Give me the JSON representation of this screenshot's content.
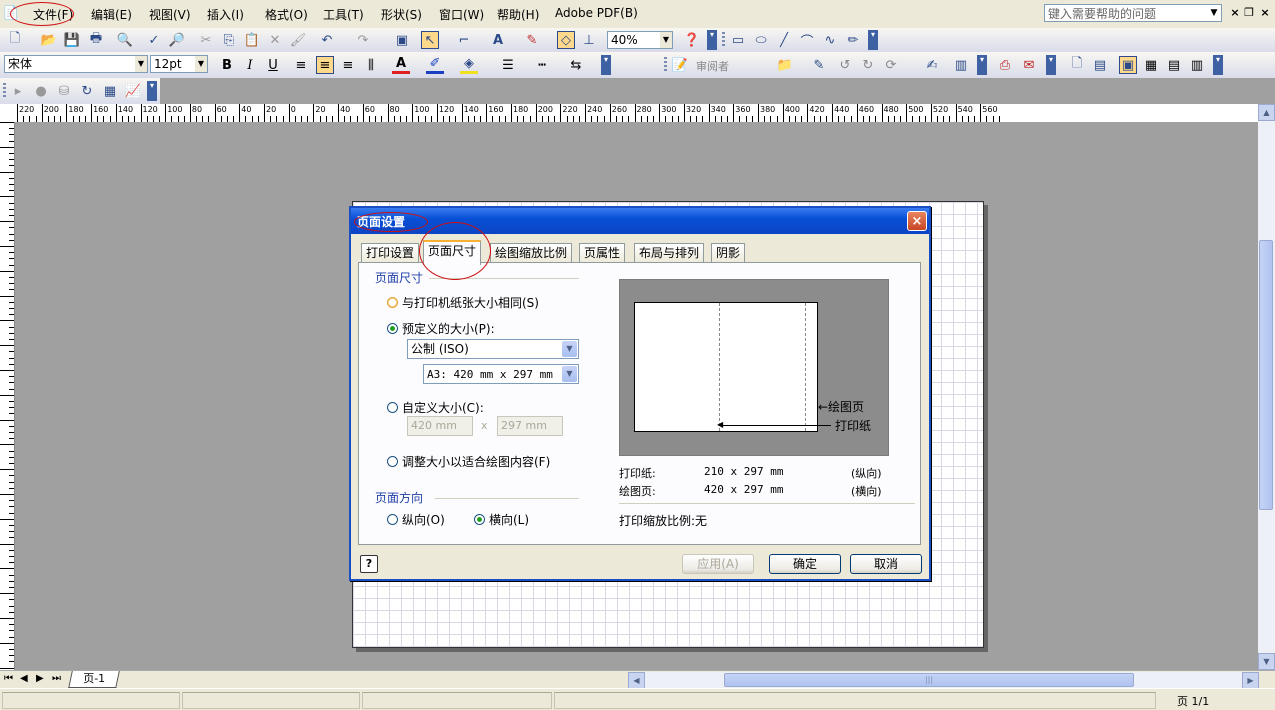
{
  "menubar": {
    "items": [
      "文件(F)",
      "编辑(E)",
      "视图(V)",
      "插入(I)",
      "格式(O)",
      "工具(T)",
      "形状(S)",
      "窗口(W)",
      "帮助(H)",
      "Adobe PDF(B)"
    ],
    "help_placeholder": "键入需要帮助的问题"
  },
  "toolbar": {
    "zoom": "40%",
    "font_name": "宋体",
    "font_size": "12pt",
    "bold": "B",
    "italic": "I",
    "underline": "U",
    "reviewer": "审阅者"
  },
  "ruler": {
    "top_labels": [
      "220",
      "200",
      "180",
      "160",
      "140",
      "120",
      "100",
      "80",
      "60",
      "40",
      "20",
      "0",
      "20",
      "40",
      "60",
      "80",
      "100",
      "120",
      "140",
      "160",
      "180",
      "200",
      "220",
      "240",
      "260",
      "280",
      "300",
      "320",
      "340",
      "360",
      "380",
      "400",
      "420",
      "440",
      "460",
      "480",
      "500",
      "520",
      "540",
      "560"
    ]
  },
  "page_tabs": {
    "current": "页-1"
  },
  "status": {
    "page": "页 1/1"
  },
  "dialog": {
    "title": "页面设置",
    "close": "×",
    "tabs": [
      "打印设置",
      "页面尺寸",
      "绘图缩放比例",
      "页属性",
      "布局与排列",
      "阴影"
    ],
    "active_tab": 1,
    "size_group": "页面尺寸",
    "opt_same_as_printer": "与打印机纸张大小相同(S)",
    "opt_predefined": "预定义的大小(P):",
    "predefined_standard": "公制 (ISO)",
    "predefined_size": "A3:  420 mm x 297 mm",
    "opt_custom": "自定义大小(C):",
    "custom_width": "420 mm",
    "custom_x": "x",
    "custom_height": "297 mm",
    "opt_fit": "调整大小以适合绘图内容(F)",
    "orientation_group": "页面方向",
    "opt_portrait": "纵向(O)",
    "opt_landscape": "横向(L)",
    "preview_drawing_label": "←绘图页",
    "preview_paper_label": "打印纸",
    "info_paper_label": "打印纸:",
    "info_paper_size": "210 x 297 mm",
    "info_paper_orient": "(纵向)",
    "info_drawing_label": "绘图页:",
    "info_drawing_size": "420 x 297 mm",
    "info_drawing_orient": "(横向)",
    "info_scale": "打印缩放比例:无",
    "help_button": "?",
    "apply": "应用(A)",
    "ok": "确定",
    "cancel": "取消"
  }
}
